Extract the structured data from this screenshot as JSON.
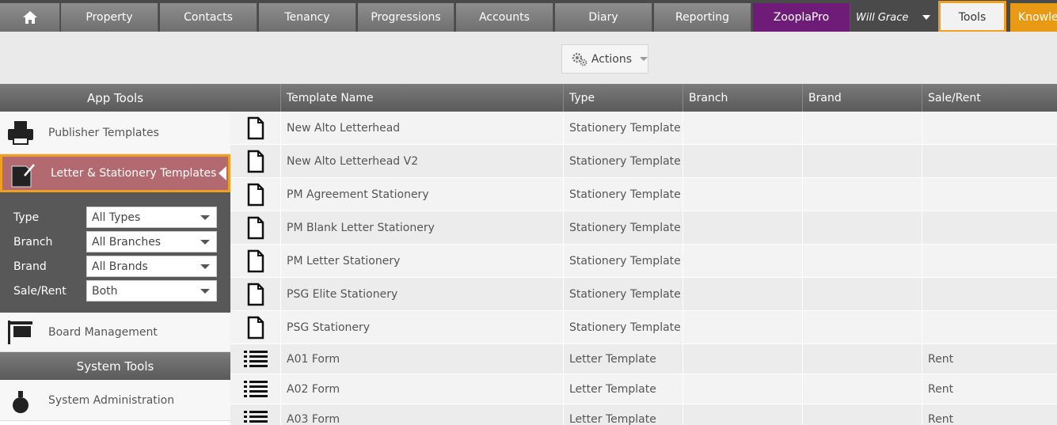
{
  "nav": {
    "tabs": [
      {
        "label": "Property"
      },
      {
        "label": "Contacts"
      },
      {
        "label": "Tenancy"
      },
      {
        "label": "Progressions"
      },
      {
        "label": "Accounts"
      },
      {
        "label": "Diary"
      },
      {
        "label": "Reporting"
      },
      {
        "label": "ZooplaPro"
      }
    ],
    "user": "Will Grace",
    "tools": "Tools",
    "knowledge": "Knowle",
    "home_icon": "home-icon"
  },
  "toolbar": {
    "actions_label": "Actions"
  },
  "sidebar": {
    "app_tools_header": "App Tools",
    "system_tools_header": "System Tools",
    "items": [
      {
        "label": "Publisher Templates",
        "icon": "printer-icon"
      },
      {
        "label": "Letter & Stationery Templates",
        "icon": "letter-icon"
      },
      {
        "label": "Board Management",
        "icon": "board-icon"
      },
      {
        "label": "System Administration",
        "icon": "admin-icon"
      }
    ],
    "filters": [
      {
        "label": "Type",
        "value": "All Types"
      },
      {
        "label": "Branch",
        "value": "All Branches"
      },
      {
        "label": "Brand",
        "value": "All Brands"
      },
      {
        "label": "Sale/Rent",
        "value": "Both"
      }
    ]
  },
  "table": {
    "columns": [
      "Template Name",
      "Type",
      "Branch",
      "Brand",
      "Sale/Rent"
    ],
    "rows": [
      {
        "name": "New Alto Letterhead",
        "type": "Stationery Template",
        "branch": "",
        "brand": "",
        "sale_rent": ""
      },
      {
        "name": "New Alto Letterhead V2",
        "type": "Stationery Template",
        "branch": "",
        "brand": "",
        "sale_rent": ""
      },
      {
        "name": "PM Agreement Stationery",
        "type": "Stationery Template",
        "branch": "",
        "brand": "",
        "sale_rent": ""
      },
      {
        "name": "PM Blank Letter Stationery",
        "type": "Stationery Template",
        "branch": "",
        "brand": "",
        "sale_rent": ""
      },
      {
        "name": "PM Letter Stationery",
        "type": "Stationery Template",
        "branch": "",
        "brand": "",
        "sale_rent": ""
      },
      {
        "name": "PSG Elite Stationery",
        "type": "Stationery Template",
        "branch": "",
        "brand": "",
        "sale_rent": ""
      },
      {
        "name": "PSG Stationery",
        "type": "Stationery Template",
        "branch": "",
        "brand": "",
        "sale_rent": ""
      },
      {
        "name": "A01 Form",
        "type": "Letter Template",
        "branch": "",
        "brand": "",
        "sale_rent": "Rent"
      },
      {
        "name": "A02 Form",
        "type": "Letter Template",
        "branch": "",
        "brand": "",
        "sale_rent": "Rent"
      },
      {
        "name": "A03 Form",
        "type": "Letter Template",
        "branch": "",
        "brand": "",
        "sale_rent": "Rent"
      }
    ]
  }
}
